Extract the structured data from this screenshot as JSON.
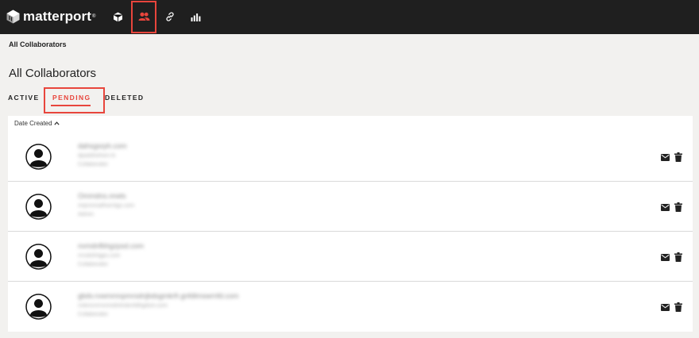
{
  "brand": {
    "name": "matterport",
    "trademark": "®"
  },
  "nav": {
    "items": [
      {
        "icon": "cube-icon"
      },
      {
        "icon": "users-icon",
        "active": true
      },
      {
        "icon": "link-icon"
      },
      {
        "icon": "bar-chart-icon"
      }
    ]
  },
  "breadcrumb": "All Collaborators",
  "page_title": "All Collaborators",
  "tabs": {
    "active": "ACTIVE",
    "pending": "PENDING",
    "deleted": "DELETED"
  },
  "sort": {
    "label": "Date Created"
  },
  "colors": {
    "accent": "#e8453c",
    "topbar": "#1f1f1f",
    "background": "#f2f1ef"
  },
  "collaborators": [
    {
      "email": "dahsgsrph.com",
      "line2": "dpaddrwhsm.fs",
      "line3": "Collaborator"
    },
    {
      "email": "Ommdns.nrwts",
      "line2": "reqrsmnalfrwrntgs.com",
      "line3": "Admin"
    },
    {
      "email": "nvmdnfbhgzpsd.com",
      "line2": "rrcsdsfntgps.com",
      "line3": "Collaborator"
    },
    {
      "email": "gbdv.rvwmmnpmrsdnjbdsgmkrfr.gnfdlmswrnfd.com",
      "line2": "rvdvncnrnvnmdntmdvnfdhgdsm.com",
      "line3": "Collaborator"
    }
  ]
}
